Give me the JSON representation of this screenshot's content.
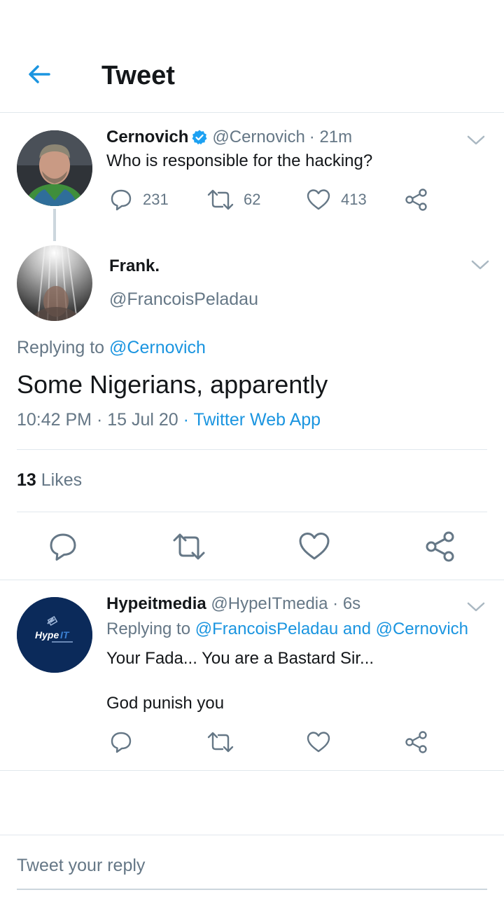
{
  "header": {
    "title": "Tweet"
  },
  "parent_tweet": {
    "name": "Cernovich",
    "handle": "@Cernovich",
    "time": "· 21m",
    "text": "Who is responsible for the hacking?",
    "replies": "231",
    "retweets": "62",
    "likes": "413"
  },
  "main_tweet": {
    "name": "Frank.",
    "handle": "@FrancoisPeladau",
    "replying_label": "Replying to",
    "replying_to": "@Cernovich",
    "text": "Some Nigerians, apparently",
    "time": "10:42 PM",
    "date": "· 15 Jul 20",
    "source": "· Twitter Web App",
    "likes_count": "13",
    "likes_label": "Likes"
  },
  "reply_tweet": {
    "name": "Hypeitmedia",
    "handle": "@HypeITmedia",
    "time": "· 6s",
    "replying_label": "Replying to",
    "replying_to": "@FrancoisPeladau and @Cernovich",
    "line1": "Your Fada... You are a Bastard Sir...",
    "line2": "God punish you",
    "avatar_text": "Hype",
    "avatar_text_accent": "IT"
  },
  "composer": {
    "placeholder": "Tweet your reply"
  },
  "colors": {
    "accent": "#1b95e0",
    "muted": "#657786",
    "verified": "#1da1f2",
    "avatar_navy": "#0b2a5a"
  }
}
